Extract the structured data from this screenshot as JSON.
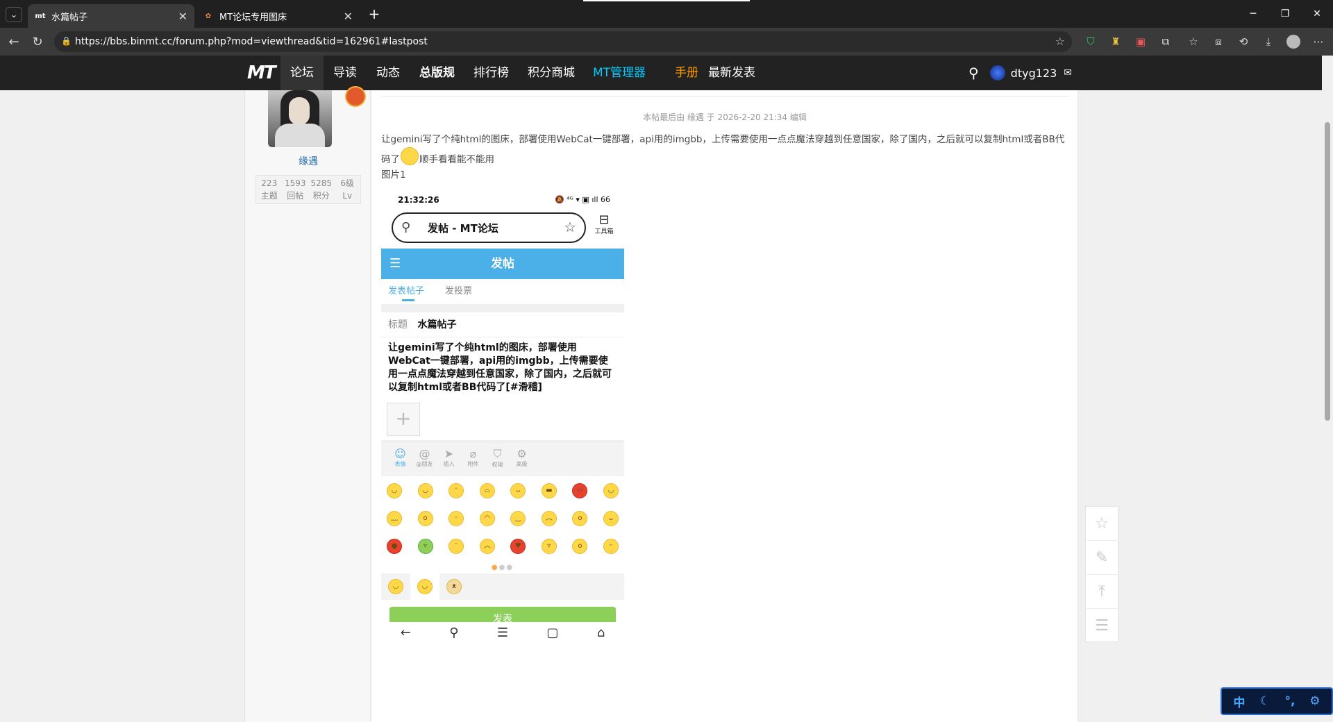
{
  "browser": {
    "tabs": [
      {
        "title": "水篇帖子",
        "favicon": "mt-icon",
        "active": true
      },
      {
        "title": "MT论坛专用图床",
        "favicon": "colorful-flower-icon",
        "active": false
      }
    ],
    "new_tab_label": "+",
    "url": "https://bbs.binmt.cc/forum.php?mod=viewthread&tid=162961#lastpost"
  },
  "site_nav": {
    "logo": "MT",
    "items": [
      {
        "label": "论坛",
        "color": "#ffffff",
        "bold": false
      },
      {
        "label": "导读",
        "color": "#ffffff",
        "bold": false
      },
      {
        "label": "动态",
        "color": "#ffffff",
        "bold": false
      },
      {
        "label": "总版规",
        "color": "#ffffff",
        "bold": true
      },
      {
        "label": "排行榜",
        "color": "#ffffff",
        "bold": false
      },
      {
        "label": "积分商城",
        "color": "#ffffff",
        "bold": false
      },
      {
        "label": "MT管理器",
        "color": "#00ccff",
        "bold": false
      },
      {
        "label": "手册",
        "color": "#ff9900",
        "bold": false
      },
      {
        "label": "最新发表",
        "color": "#ffffff",
        "bold": false
      }
    ],
    "username": "dtyg123"
  },
  "author": {
    "name": "缘遇",
    "stats": [
      {
        "value": "223",
        "label": "主题"
      },
      {
        "value": "1593",
        "label": "回帖"
      },
      {
        "value": "5285",
        "label": "积分"
      },
      {
        "value": "6级",
        "label": "Lv"
      }
    ]
  },
  "post": {
    "edit_note": "本帖最后由 缘遇 于 2026-2-20 21:34 编辑",
    "text_part1": "让gemini写了个纯html的图床，部署使用WebCat一键部署，api用的imgbb，上传需要使用一点点魔法穿越到任意国家，除了国内，之后就可以复制html或者BB代码了",
    "text_part2": "顺手看看能不能用",
    "image_caption": "图片1"
  },
  "phone": {
    "time": "21:32:26",
    "status_right": "🔕 ⁴ᴳ ▾ ▣ ıll 66",
    "url_title": "发帖 - MT论坛",
    "tools_label": "工具箱",
    "header_title": "发帖",
    "tabs": [
      "发表帖子",
      "发投票"
    ],
    "title_label": "标题",
    "title_value": "水篇帖子",
    "body": "让gemini写了个纯html的图床，部署使用WebCat一键部署，api用的imgbb，上传需要使用一点点魔法穿越到任意国家，除了国内，之后就可以复制html或者BB代码了[#滑稽]",
    "toolbar": [
      {
        "icon": "smile-icon",
        "label": "表情"
      },
      {
        "icon": "at-icon",
        "label": "@朋友"
      },
      {
        "icon": "paper-plane-icon",
        "label": "插入"
      },
      {
        "icon": "paperclip-icon",
        "label": "附件"
      },
      {
        "icon": "shield-icon",
        "label": "权限"
      },
      {
        "icon": "gear-icon",
        "label": "高级"
      }
    ],
    "send_label": "发表"
  },
  "ime": {
    "mode": "中"
  }
}
